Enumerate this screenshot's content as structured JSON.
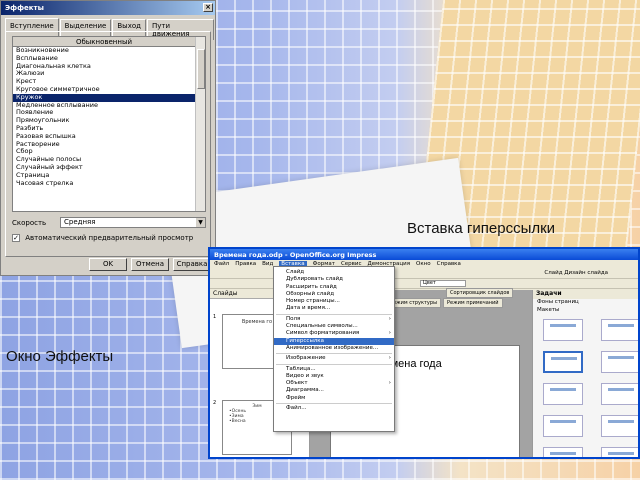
{
  "captions": {
    "effects": "Окно Эффекты",
    "hyperlink": "Вставка гиперссылки"
  },
  "effects_dialog": {
    "title": "Эффекты",
    "close_glyph": "×",
    "tabs": [
      "Вступление",
      "Выделение",
      "Выход",
      "Пути движения"
    ],
    "list_header": "Обыкновенный",
    "items": [
      "Возникновение",
      "Всплывание",
      "Диагональная клетка",
      "Жалюзи",
      "Крест",
      "Круговое симметричное",
      "Кружок",
      "Медленное всплывание",
      "Появление",
      "Прямоугольник",
      "Разбить",
      "Разовая вспышка",
      "Растворение",
      "Сбор",
      "Случайные полосы",
      "Случайный эффект",
      "Страница",
      "Часовая стрелка"
    ],
    "selected_item": "Кружок",
    "speed_label": "Скорость",
    "speed_value": "Средняя",
    "auto_preview_label": "Автоматический предварительный просмотр",
    "auto_preview_checked": true,
    "buttons": {
      "ok": "OK",
      "cancel": "Отмена",
      "help": "Справка"
    }
  },
  "impress": {
    "title": "Времена года.odp - OpenOffice.org Impress",
    "menus": [
      "Файл",
      "Правка",
      "Вид",
      "Вставка",
      "Формат",
      "Сервис",
      "Демонстрация",
      "Окно",
      "Справка"
    ],
    "open_menu": "Вставка",
    "toolbar_right": "Слайд   Дизайн слайда",
    "color_field": "Цвет",
    "slides_pane_title": "Слайды",
    "thumb1_title": "Времена го",
    "thumb2_title": "Зим",
    "thumb2_bullets": [
      "•Осень",
      "•Зима",
      "•Весна"
    ],
    "view_tabs": [
      "Режим структуры",
      "Режим примечаний",
      "Сортировщик слайдов"
    ],
    "slide_title": "Времена года",
    "tasks_title": "Задачи",
    "tasks_sections": [
      "Фоны страниц",
      "Макеты"
    ],
    "layout_count": 10,
    "selected_layout_index": 2
  },
  "insert_menu": {
    "items": [
      {
        "label": "Слайд",
        "sub": false
      },
      {
        "label": "Дублировать слайд",
        "sub": false
      },
      {
        "label": "Расширить слайд",
        "sub": false
      },
      {
        "label": "Обзорный слайд",
        "sub": false
      },
      {
        "label": "Номер страницы...",
        "sub": false
      },
      {
        "label": "Дата и время...",
        "sub": false
      },
      {
        "label": "Поля",
        "sub": true
      },
      {
        "label": "Специальные символы...",
        "sub": false
      },
      {
        "label": "Символ форматирования",
        "sub": true
      },
      {
        "label": "Гиперссылка",
        "sub": false
      },
      {
        "label": "Анимированное изображение...",
        "sub": false
      },
      {
        "label": "Изображение",
        "sub": true
      },
      {
        "label": "Таблица...",
        "sub": false
      },
      {
        "label": "Видео и звук",
        "sub": false
      },
      {
        "label": "Объект",
        "sub": true
      },
      {
        "label": "Диаграмма...",
        "sub": false
      },
      {
        "label": "Фрейм",
        "sub": false
      },
      {
        "label": "Файл...",
        "sub": false
      }
    ],
    "highlighted": "Гиперссылка"
  }
}
